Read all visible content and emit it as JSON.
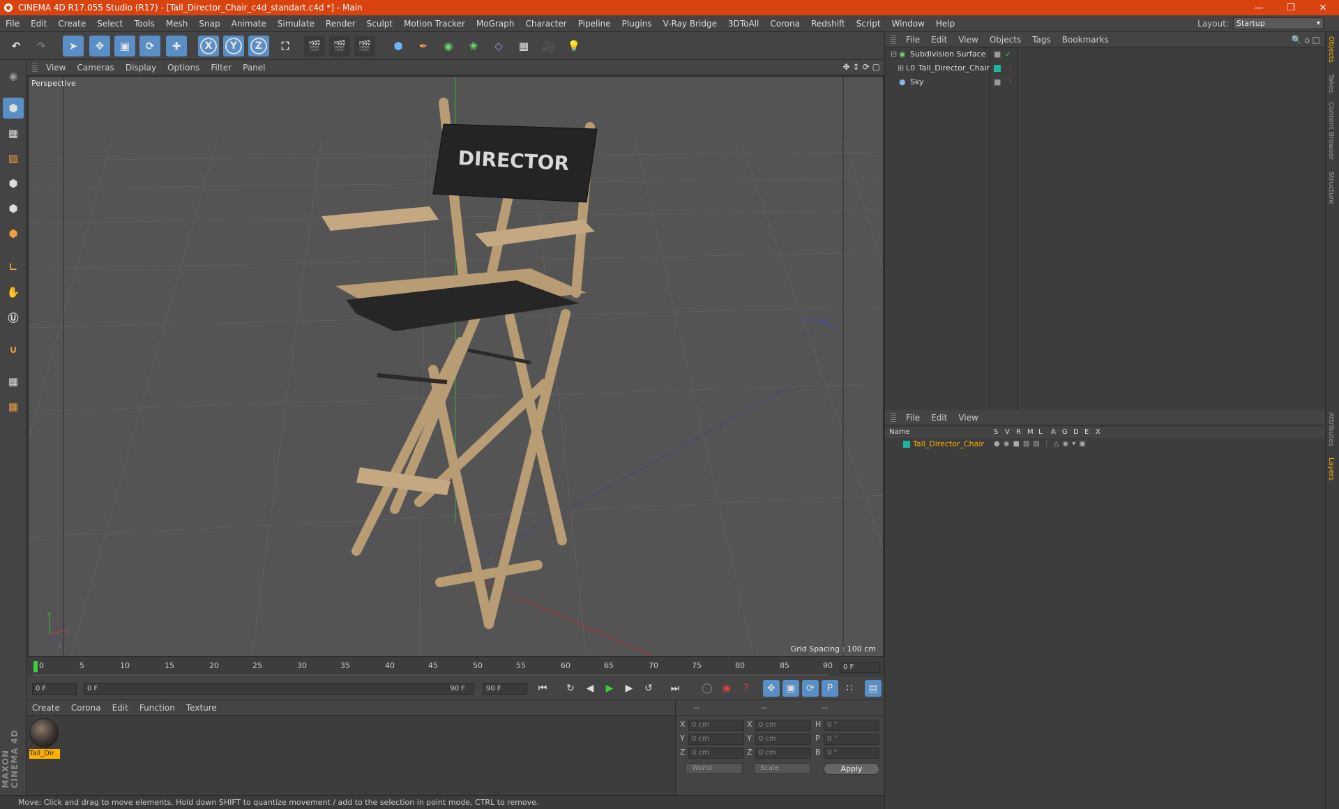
{
  "window": {
    "title": "CINEMA 4D R17.055 Studio (R17) - [Tall_Director_Chair_c4d_standart.c4d *] - Main"
  },
  "menubar": {
    "items": [
      "File",
      "Edit",
      "Create",
      "Select",
      "Tools",
      "Mesh",
      "Snap",
      "Animate",
      "Simulate",
      "Render",
      "Sculpt",
      "Motion Tracker",
      "MoGraph",
      "Character",
      "Pipeline",
      "Plugins",
      "V-Ray Bridge",
      "3DToAll",
      "Corona",
      "Redshift",
      "Script",
      "Window",
      "Help"
    ],
    "layout_label": "Layout:",
    "layout_value": "Startup"
  },
  "viewport": {
    "menu": [
      "View",
      "Cameras",
      "Display",
      "Options",
      "Filter",
      "Panel"
    ],
    "label": "Perspective",
    "grid_spacing": "Grid Spacing : 100 cm",
    "chair_text": "DIRECTOR"
  },
  "timeline": {
    "ticks": [
      "0",
      "5",
      "10",
      "15",
      "20",
      "25",
      "30",
      "35",
      "40",
      "45",
      "50",
      "55",
      "60",
      "65",
      "70",
      "75",
      "80",
      "85",
      "90"
    ],
    "current_frame": "0 F"
  },
  "transport": {
    "start": "0 F",
    "range_start": "0 F",
    "range_end": "90 F",
    "end": "90 F"
  },
  "material_manager": {
    "menu": [
      "Create",
      "Corona",
      "Edit",
      "Function",
      "Texture"
    ],
    "material_name": "Tall_Dir"
  },
  "coords": {
    "headers": [
      "--",
      "--",
      "--"
    ],
    "labels_pos": [
      "X",
      "Y",
      "Z"
    ],
    "labels_size": [
      "X",
      "Y",
      "Z"
    ],
    "labels_rot": [
      "H",
      "P",
      "B"
    ],
    "pos": [
      "0 cm",
      "0 cm",
      "0 cm"
    ],
    "size": [
      "0 cm",
      "0 cm",
      "0 cm"
    ],
    "rot": [
      "0 °",
      "0 °",
      "0 °"
    ],
    "space": "World",
    "mode": "Scale",
    "apply": "Apply"
  },
  "status": "Move: Click and drag to move elements. Hold down SHIFT to quantize movement / add to the selection in point mode, CTRL to remove.",
  "object_manager": {
    "menu": [
      "File",
      "Edit",
      "View",
      "Objects",
      "Tags",
      "Bookmarks"
    ],
    "objects": [
      "Subdivision Surface",
      "Tall_Director_Chair",
      "Sky"
    ]
  },
  "layer_manager": {
    "menu": [
      "File",
      "Edit",
      "View"
    ],
    "columns": [
      "Name",
      "S",
      "V",
      "R",
      "M",
      "L",
      "A",
      "G",
      "D",
      "E",
      "X"
    ],
    "layer_name": "Tall_Director_Chair"
  },
  "side_tabs": [
    "Objects",
    "Takes",
    "Content Browser",
    "Structure",
    "Attributes",
    "Layers"
  ],
  "colors": {
    "accent": "#d94310",
    "active_tool": "#5a8fc6",
    "layer_color": "#1ab8a0",
    "selected_text": "#ffb000"
  }
}
